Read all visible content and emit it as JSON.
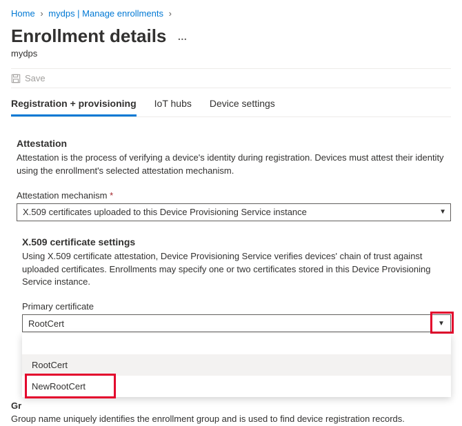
{
  "breadcrumb": {
    "home": "Home",
    "mid": "mydps | Manage enrollments"
  },
  "header": {
    "title": "Enrollment details",
    "subtitle": "mydps"
  },
  "toolbar": {
    "save_label": "Save"
  },
  "tabs": {
    "reg": "Registration + provisioning",
    "iot": "IoT hubs",
    "dev": "Device settings"
  },
  "attestation": {
    "title": "Attestation",
    "desc": "Attestation is the process of verifying a device's identity during registration. Devices must attest their identity using the enrollment's selected attestation mechanism.",
    "mech_label": "Attestation mechanism",
    "mech_value": "X.509 certificates uploaded to this Device Provisioning Service instance"
  },
  "x509": {
    "title": "X.509 certificate settings",
    "desc": "Using X.509 certificate attestation, Device Provisioning Service verifies devices' chain of trust against uploaded certificates. Enrollments may specify one or two certificates stored in this Device Provisioning Service instance.",
    "primary_label": "Primary certificate",
    "primary_value": "RootCert",
    "options": {
      "root": "RootCert",
      "newroot": "NewRootCert"
    }
  },
  "group": {
    "label_prefix": "Gr",
    "desc": "Group name uniquely identifies the enrollment group and is used to find device registration records."
  }
}
